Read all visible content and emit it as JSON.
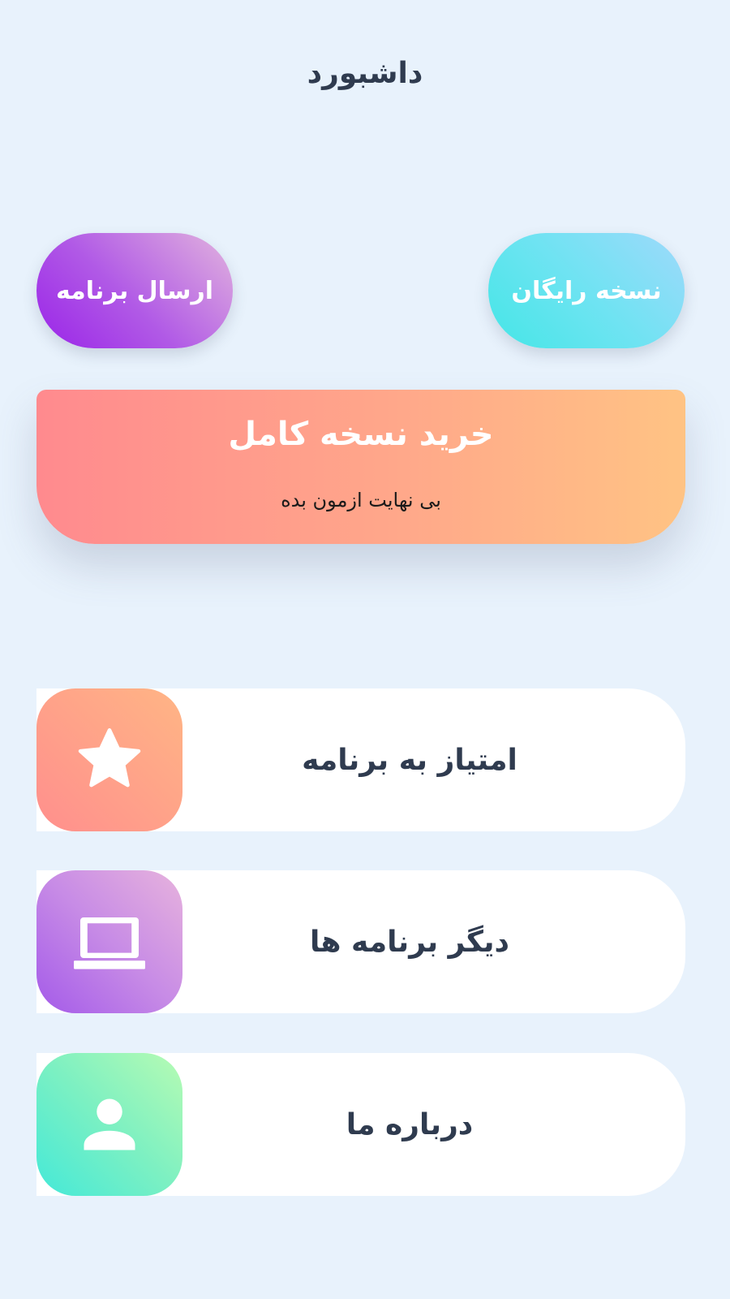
{
  "header": {
    "title": "داشبورد"
  },
  "top_buttons": {
    "send_app_label": "ارسال برنامه",
    "free_version_label": "نسخه رایگان"
  },
  "promo": {
    "title": "خرید نسخه کامل",
    "subtitle": "بی نهایت ازمون بده"
  },
  "menu": {
    "items": [
      {
        "label": "امتیاز به برنامه",
        "icon": "star-icon"
      },
      {
        "label": "دیگر برنامه ها",
        "icon": "laptop-icon"
      },
      {
        "label": "درباره ما",
        "icon": "person-icon"
      }
    ]
  },
  "colors": {
    "background": "#e8f2fc",
    "text_dark": "#2f3b4f",
    "send_gradient": [
      "#9a24e8",
      "#e2b4de"
    ],
    "free_gradient": [
      "#44e6e6",
      "#9fd9fb"
    ],
    "promo_gradient": [
      "#ff8a8e",
      "#ffc384"
    ],
    "rate_icon_gradient": [
      "#ff8f8d",
      "#ffb585"
    ],
    "apps_icon_gradient": [
      "#a45ae9",
      "#e7b3dd"
    ],
    "about_icon_gradient": [
      "#44e9d8",
      "#b7fbb3"
    ]
  }
}
